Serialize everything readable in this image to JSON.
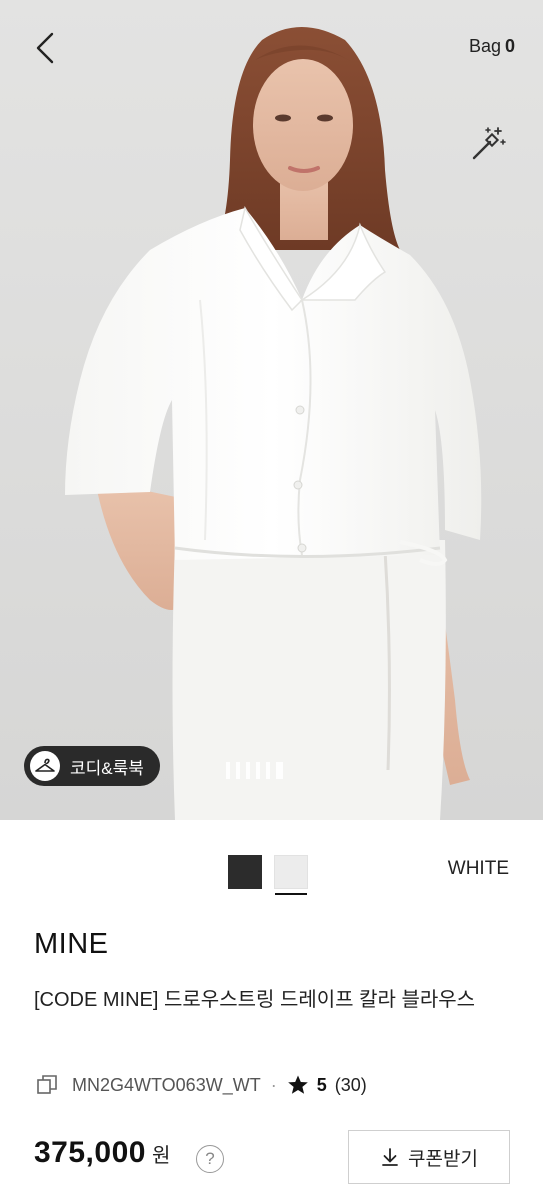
{
  "header": {
    "back_icon": "chevron-left-icon",
    "bag_label": "Bag",
    "bag_count": "0",
    "wand_icon": "magic-wand-icon"
  },
  "gallery": {
    "lookbook_label": "코디&룩북",
    "lookbook_icon": "hanger-icon",
    "page_count": 6,
    "active_page": 6
  },
  "product": {
    "color_swatches": [
      {
        "name": "black",
        "color": "#2c2c2c"
      },
      {
        "name": "white",
        "color": "#ececec"
      }
    ],
    "selected_color": "WHITE",
    "brand": "MINE",
    "title": "[CODE MINE] 드로우스트링 드레이프 칼라 블라우스",
    "code": "MN2G4WTO063W_WT",
    "rating": "5",
    "review_count": "(30)",
    "price": "375,000",
    "currency": "원",
    "help_symbol": "?",
    "coupon_label": "쿠폰받기",
    "coupon_icon": "download-icon"
  }
}
